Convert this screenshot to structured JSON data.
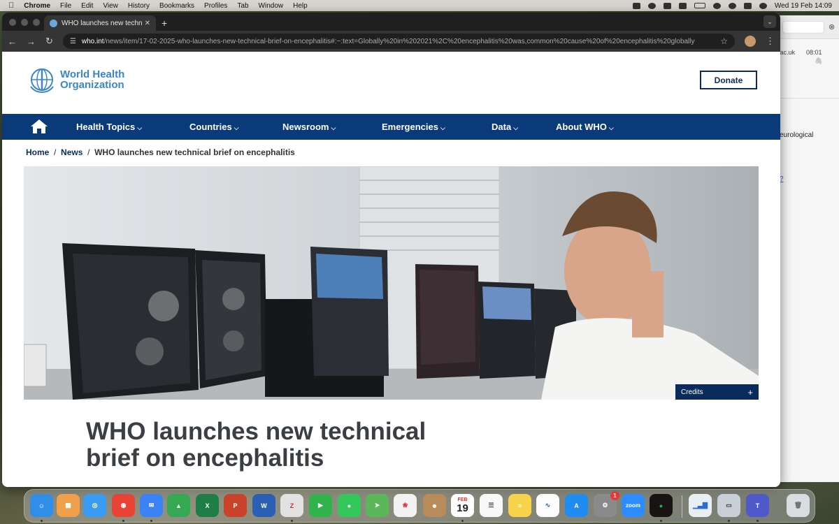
{
  "menubar": {
    "app_name": "Chrome",
    "menus": [
      "File",
      "Edit",
      "View",
      "History",
      "Bookmarks",
      "Profiles",
      "Tab",
      "Window",
      "Help"
    ],
    "clock": "Wed 19 Feb  14:09"
  },
  "browser": {
    "tab_title": "WHO launches new technical",
    "url_host": "who.int",
    "url_path": "/news/item/17-02-2025-who-launches-new-technical-brief-on-encephalitis#:~:text=Globally%20in%202021%2C%20encephalitis%20was,common%20cause%20of%20encephalitis%20globally"
  },
  "background_window": {
    "sender_fragment": ".ac.uk",
    "time": "08:01",
    "text_fragment": "eurological",
    "link_fragment": "?"
  },
  "site": {
    "logo_line1": "World Health",
    "logo_line2": "Organization",
    "donate_label": "Donate",
    "nav": [
      "Health Topics",
      "Countries",
      "Newsroom",
      "Emergencies",
      "Data",
      "About WHO"
    ],
    "breadcrumb": {
      "home": "Home",
      "news": "News",
      "current": "WHO launches new technical brief on encephalitis"
    },
    "credits_label": "Credits",
    "article_title": "WHO launches new technical brief on encephalitis"
  },
  "dock": {
    "calendar_month": "FEB",
    "calendar_day": "19",
    "settings_badge": "1",
    "zoom_label": "zoom"
  }
}
